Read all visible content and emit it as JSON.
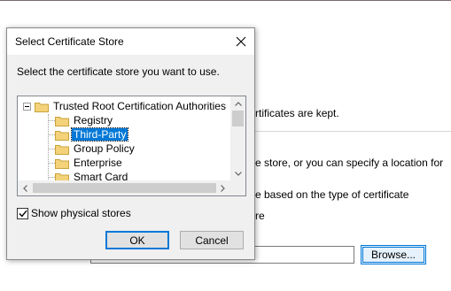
{
  "background": {
    "text_kept": "rtificates are kept.",
    "text_store": "e store, or you can specify a location for",
    "text_based": "e based on the type of certificate",
    "text_re": "re",
    "browse_label": "Browse..."
  },
  "dialog": {
    "title": "Select Certificate Store",
    "instruction": "Select the certificate store you want to use.",
    "tree": {
      "root": "Trusted Root Certification Authorities",
      "children": [
        "Registry",
        "Third-Party",
        "Group Policy",
        "Enterprise",
        "Smart Card"
      ],
      "selected": "Third-Party"
    },
    "show_physical_label": "Show physical stores",
    "show_physical_checked": true,
    "ok_label": "OK",
    "cancel_label": "Cancel"
  },
  "colors": {
    "selection": "#0078d7",
    "folder": "#f3d27a"
  }
}
